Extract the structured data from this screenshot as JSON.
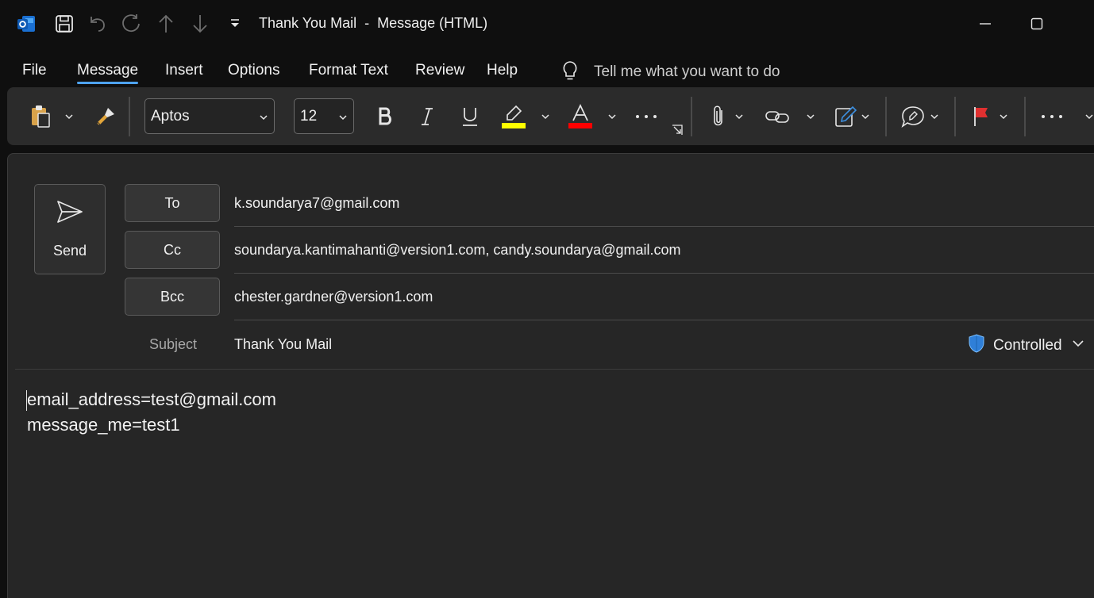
{
  "window": {
    "title": "Thank You Mail  -  Message (HTML)",
    "app_icon": "outlook-icon",
    "quick_access": [
      "save-icon",
      "undo-icon",
      "redo-icon",
      "up-arrow-icon",
      "down-arrow-icon",
      "customize-dropdown-icon"
    ],
    "controls": [
      "minimize-icon",
      "maximize-icon"
    ]
  },
  "menu": {
    "items": [
      "File",
      "Message",
      "Insert",
      "Options",
      "Format Text",
      "Review",
      "Help"
    ],
    "active": "Message",
    "tell_me": "Tell me what you want to do"
  },
  "ribbon": {
    "font_name": "Aptos",
    "font_size": "12",
    "highlight_color": "#ffff00",
    "font_color": "#ff0000",
    "buttons": [
      "paste-icon",
      "format-painter-icon",
      "bold-icon",
      "italic-icon",
      "underline-icon",
      "highlight-icon",
      "font-color-icon",
      "more-icon",
      "attach-icon",
      "link-icon",
      "signature-icon",
      "comment-icon",
      "flag-icon",
      "more-icon"
    ]
  },
  "compose": {
    "send_label": "Send",
    "to_label": "To",
    "cc_label": "Cc",
    "bcc_label": "Bcc",
    "subject_label": "Subject",
    "to": "k.soundarya7@gmail.com",
    "cc": "soundarya.kantimahanti@version1.com, candy.soundarya@gmail.com",
    "bcc": "chester.gardner@version1.com",
    "subject": "Thank You Mail",
    "sensitivity": "Controlled",
    "body_lines": [
      "email_address=test@gmail.com",
      "message_me=test1"
    ]
  },
  "colors": {
    "accent": "#4ea3f0",
    "shield": "#2f7fd8",
    "flag": "#e03030"
  }
}
